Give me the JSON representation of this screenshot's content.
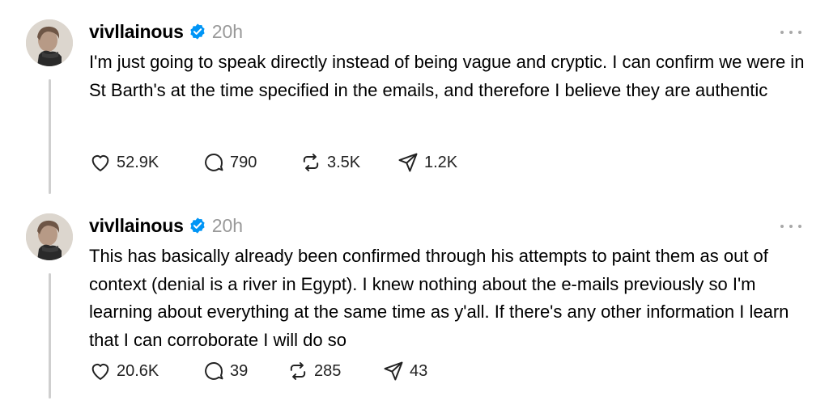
{
  "posts": [
    {
      "username": "vivllainous",
      "time": "20h",
      "text": "I'm just going to speak directly instead of being vague and cryptic. I can confirm we were in St Barth's at the time specified in the emails, and therefore I believe they are authentic",
      "likes": "52.9K",
      "replies": "790",
      "reposts": "3.5K",
      "shares": "1.2K"
    },
    {
      "username": "vivllainous",
      "time": "20h",
      "text": "This has basically already been confirmed through his attempts to paint them as out of context (denial is a river in Egypt). I knew nothing about the e-mails previously so I'm learning about everything at the same time as y'all. If there's any other information I learn that I can corroborate I will do so",
      "likes": "20.6K",
      "replies": "39",
      "reposts": "285",
      "shares": "43"
    }
  ],
  "colors": {
    "verified": "#0095f6",
    "muted": "#999999",
    "thread_line": "#cfcfcf"
  },
  "icons": [
    "heart-icon",
    "comment-icon",
    "repost-icon",
    "share-icon",
    "more-icon",
    "verified-icon"
  ]
}
